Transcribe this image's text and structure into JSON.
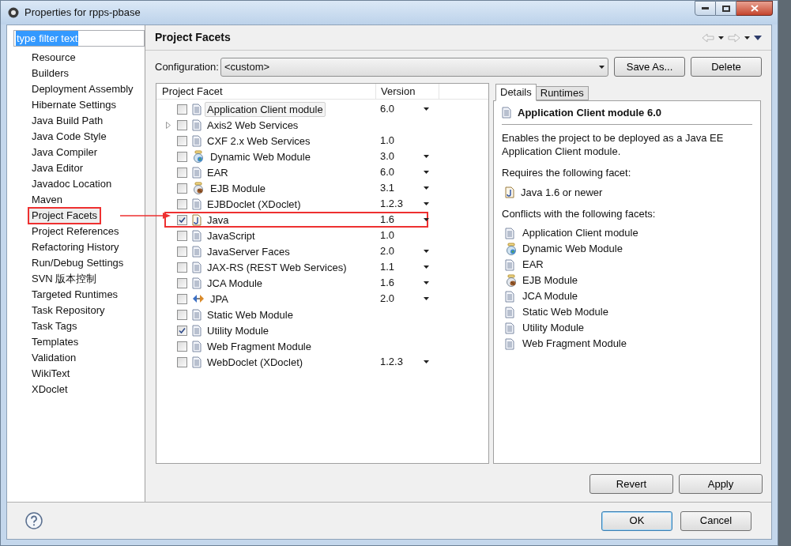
{
  "window": {
    "title": "Properties for rpps-pbase"
  },
  "filter": {
    "value": "type filter text",
    "text_selected": true
  },
  "sidebar": {
    "items": [
      {
        "label": "Resource",
        "selected": false,
        "highlighted": false
      },
      {
        "label": "Builders",
        "selected": false,
        "highlighted": false
      },
      {
        "label": "Deployment Assembly",
        "selected": false,
        "highlighted": false
      },
      {
        "label": "Hibernate Settings",
        "selected": false,
        "highlighted": false
      },
      {
        "label": "Java Build Path",
        "selected": false,
        "highlighted": false
      },
      {
        "label": "Java Code Style",
        "selected": false,
        "highlighted": false
      },
      {
        "label": "Java Compiler",
        "selected": false,
        "highlighted": false
      },
      {
        "label": "Java Editor",
        "selected": false,
        "highlighted": false
      },
      {
        "label": "Javadoc Location",
        "selected": false,
        "highlighted": false
      },
      {
        "label": "Maven",
        "selected": false,
        "highlighted": false
      },
      {
        "label": "Project Facets",
        "selected": true,
        "highlighted": true
      },
      {
        "label": "Project References",
        "selected": false,
        "highlighted": false
      },
      {
        "label": "Refactoring History",
        "selected": false,
        "highlighted": false
      },
      {
        "label": "Run/Debug Settings",
        "selected": false,
        "highlighted": false
      },
      {
        "label": "SVN 版本控制",
        "selected": false,
        "highlighted": false
      },
      {
        "label": "Targeted Runtimes",
        "selected": false,
        "highlighted": false
      },
      {
        "label": "Task Repository",
        "selected": false,
        "highlighted": false
      },
      {
        "label": "Task Tags",
        "selected": false,
        "highlighted": false
      },
      {
        "label": "Templates",
        "selected": false,
        "highlighted": false
      },
      {
        "label": "Validation",
        "selected": false,
        "highlighted": false
      },
      {
        "label": "WikiText",
        "selected": false,
        "highlighted": false
      },
      {
        "label": "XDoclet",
        "selected": false,
        "highlighted": false
      }
    ]
  },
  "page": {
    "title": "Project Facets",
    "configuration_label": "Configuration:",
    "configuration_value": "<custom>",
    "buttons": [
      "Save As...",
      "Delete"
    ]
  },
  "facets": {
    "columns": [
      "Project Facet",
      "Version"
    ],
    "rows": [
      {
        "label": "Application Client module",
        "kind": "doc",
        "checked": false,
        "selected": true,
        "expandable": false,
        "version": "6.0",
        "dropdown": true,
        "highlighted": false
      },
      {
        "label": "Axis2 Web Services",
        "kind": "doc",
        "checked": false,
        "selected": false,
        "expandable": true,
        "highlighted": false
      },
      {
        "label": "CXF 2.x Web Services",
        "kind": "doc",
        "checked": false,
        "selected": false,
        "expandable": false,
        "version": "1.0",
        "dropdown": false,
        "highlighted": false
      },
      {
        "label": "Dynamic Web Module",
        "kind": "globe",
        "checked": false,
        "selected": false,
        "expandable": false,
        "version": "3.0",
        "dropdown": true,
        "highlighted": false
      },
      {
        "label": "EAR",
        "kind": "doc",
        "checked": false,
        "selected": false,
        "expandable": false,
        "version": "6.0",
        "dropdown": true,
        "highlighted": false
      },
      {
        "label": "EJB Module",
        "kind": "bean",
        "checked": false,
        "selected": false,
        "expandable": false,
        "version": "3.1",
        "dropdown": true,
        "highlighted": false
      },
      {
        "label": "EJBDoclet (XDoclet)",
        "kind": "doc",
        "checked": false,
        "selected": false,
        "expandable": false,
        "version": "1.2.3",
        "dropdown": true,
        "highlighted": false
      },
      {
        "label": "Java",
        "kind": "java",
        "checked": true,
        "selected": false,
        "expandable": false,
        "version": "1.6",
        "dropdown": true,
        "highlighted": true
      },
      {
        "label": "JavaScript",
        "kind": "doc",
        "checked": false,
        "selected": false,
        "expandable": false,
        "version": "1.0",
        "dropdown": false,
        "highlighted": false
      },
      {
        "label": "JavaServer Faces",
        "kind": "doc",
        "checked": false,
        "selected": false,
        "expandable": false,
        "version": "2.0",
        "dropdown": true,
        "highlighted": false
      },
      {
        "label": "JAX-RS (REST Web Services)",
        "kind": "doc",
        "checked": false,
        "selected": false,
        "expandable": false,
        "version": "1.1",
        "dropdown": true,
        "highlighted": false
      },
      {
        "label": "JCA Module",
        "kind": "doc",
        "checked": false,
        "selected": false,
        "expandable": false,
        "version": "1.6",
        "dropdown": true,
        "highlighted": false
      },
      {
        "label": "JPA",
        "kind": "jpa",
        "checked": false,
        "selected": false,
        "expandable": false,
        "version": "2.0",
        "dropdown": true,
        "highlighted": false
      },
      {
        "label": "Static Web Module",
        "kind": "doc",
        "checked": false,
        "selected": false,
        "expandable": false,
        "highlighted": false
      },
      {
        "label": "Utility Module",
        "kind": "doc",
        "checked": true,
        "selected": false,
        "expandable": false,
        "highlighted": false
      },
      {
        "label": "Web Fragment Module",
        "kind": "doc",
        "checked": false,
        "selected": false,
        "expandable": false,
        "highlighted": false
      },
      {
        "label": "WebDoclet (XDoclet)",
        "kind": "doc",
        "checked": false,
        "selected": false,
        "expandable": false,
        "version": "1.2.3",
        "dropdown": true,
        "highlighted": false
      }
    ]
  },
  "details": {
    "tabs": [
      {
        "label": "Details",
        "selected": true
      },
      {
        "label": "Runtimes",
        "selected": false
      }
    ],
    "title": "Application Client module 6.0",
    "description": "Enables the project to be deployed as a Java EE Application Client module.",
    "requires_heading": "Requires the following facet:",
    "requires": [
      {
        "label": "Java 1.6 or newer",
        "kind": "java"
      }
    ],
    "conflicts_heading": "Conflicts with the following facets:",
    "conflicts": [
      {
        "label": "Application Client module",
        "kind": "doc"
      },
      {
        "label": "Dynamic Web Module",
        "kind": "globe"
      },
      {
        "label": "EAR",
        "kind": "doc"
      },
      {
        "label": "EJB Module",
        "kind": "bean"
      },
      {
        "label": "JCA Module",
        "kind": "doc"
      },
      {
        "label": "Static Web Module",
        "kind": "doc"
      },
      {
        "label": "Utility Module",
        "kind": "doc"
      },
      {
        "label": "Web Fragment Module",
        "kind": "doc"
      }
    ]
  },
  "page_buttons": [
    "Revert",
    "Apply"
  ],
  "dialog_buttons": [
    {
      "label": "OK",
      "default": true
    },
    {
      "label": "Cancel",
      "default": false
    }
  ]
}
